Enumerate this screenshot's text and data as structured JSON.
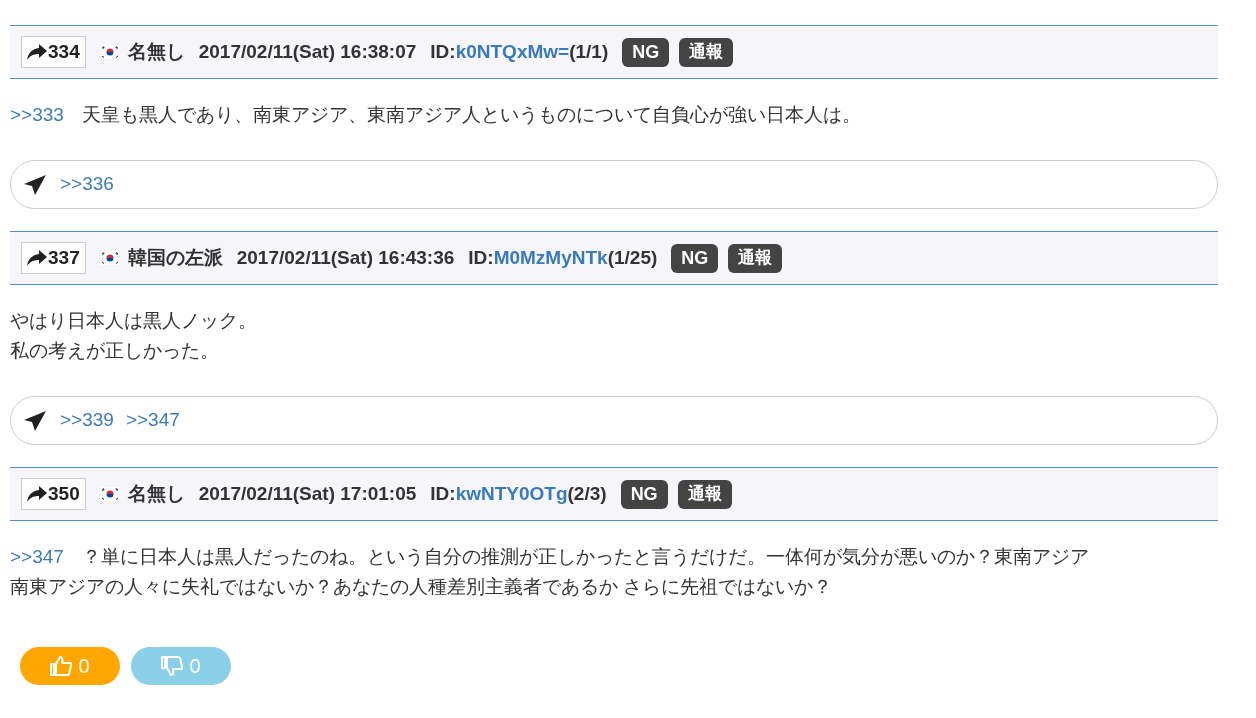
{
  "posts": [
    {
      "number": "334",
      "name": "名無し",
      "date": "2017/02/11(Sat) 16:38:07",
      "id_label": "ID:",
      "id": "k0NTQxMw=",
      "count": "(1/1)",
      "ng": "NG",
      "report": "通報",
      "anchor": ">>333",
      "lines": [
        "天皇も黒人であり、南東アジア、東南アジア人というものについて自負心が強い日本人は。"
      ],
      "replies": [
        ">>336"
      ]
    },
    {
      "number": "337",
      "name": "韓国の左派",
      "date": "2017/02/11(Sat) 16:43:36",
      "id_label": "ID:",
      "id": "M0MzMyNTk",
      "count": "(1/25)",
      "ng": "NG",
      "report": "通報",
      "lines": [
        "やはり日本人は黒人ノック。",
        "私の考えが正しかった。"
      ],
      "replies": [
        ">>339",
        ">>347"
      ]
    },
    {
      "number": "350",
      "name": "名無し",
      "date": "2017/02/11(Sat) 17:01:05",
      "id_label": "ID:",
      "id": "kwNTY0OTg",
      "count": "(2/3)",
      "ng": "NG",
      "report": "通報",
      "anchor": ">>347",
      "lines": [
        "？単に日本人は黒人だったのね。という自分の推測が正しかったと言うだけだ。一体何が気分が悪いのか？東南アジア",
        "南東アジアの人々に失礼ではないか？あなたの人種差別主義者であるか さらに先祖ではないか？"
      ],
      "votes": {
        "up": "0",
        "down": "0"
      }
    }
  ]
}
